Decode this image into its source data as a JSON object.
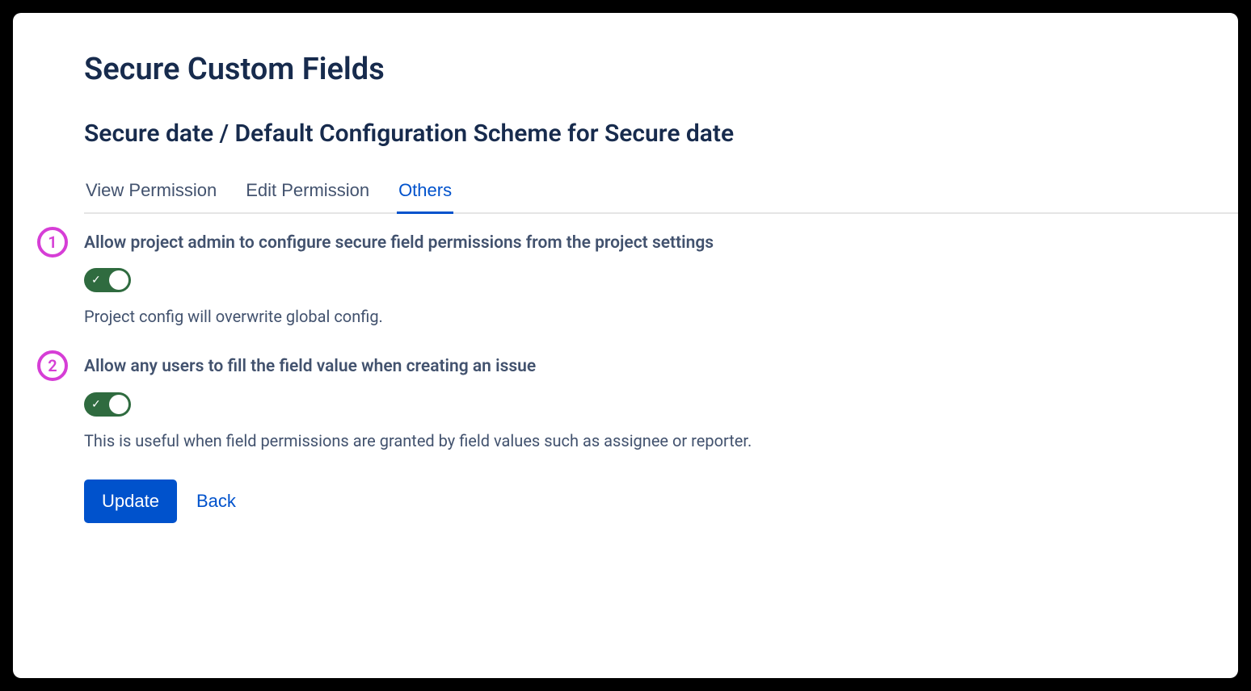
{
  "page_title": "Secure Custom Fields",
  "subtitle": "Secure date / Default Configuration Scheme for Secure date",
  "tabs": [
    {
      "label": "View Permission",
      "active": false
    },
    {
      "label": "Edit Permission",
      "active": false
    },
    {
      "label": "Others",
      "active": true
    }
  ],
  "annotations": {
    "one": "1",
    "two": "2"
  },
  "settings": {
    "project_admin": {
      "label": "Allow project admin to configure secure field permissions from the project settings",
      "enabled": true,
      "help": "Project config will overwrite global config."
    },
    "any_users_fill": {
      "label": "Allow any users to fill the field value when creating an issue",
      "enabled": true,
      "help": "This is useful when field permissions are granted by field values such as assignee or reporter."
    }
  },
  "buttons": {
    "update": "Update",
    "back": "Back"
  }
}
